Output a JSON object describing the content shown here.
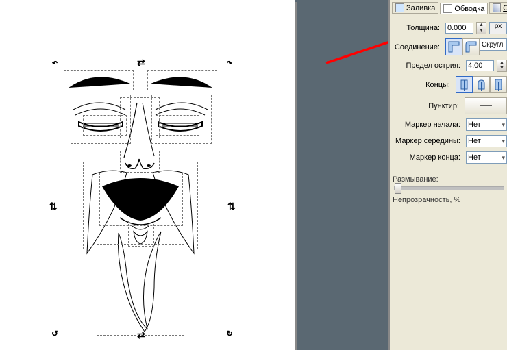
{
  "tabs": {
    "fill": "Заливка",
    "stroke": "Обводка",
    "style": "Стиль"
  },
  "stroke": {
    "width_label": "Толщина:",
    "width_value": "0.000",
    "unit": "px",
    "join_label": "Соединение:",
    "join_extra": "Скругл",
    "miter_label": "Предел острия:",
    "miter_value": "4.00",
    "cap_label": "Концы:",
    "dash_label": "Пунктир:"
  },
  "markers": {
    "start_label": "Маркер начала:",
    "mid_label": "Маркер середины:",
    "end_label": "Маркер конца:",
    "none": "Нет"
  },
  "blur": {
    "label": "Размывание:"
  },
  "opacity": {
    "label": "Непрозрачность, %"
  }
}
